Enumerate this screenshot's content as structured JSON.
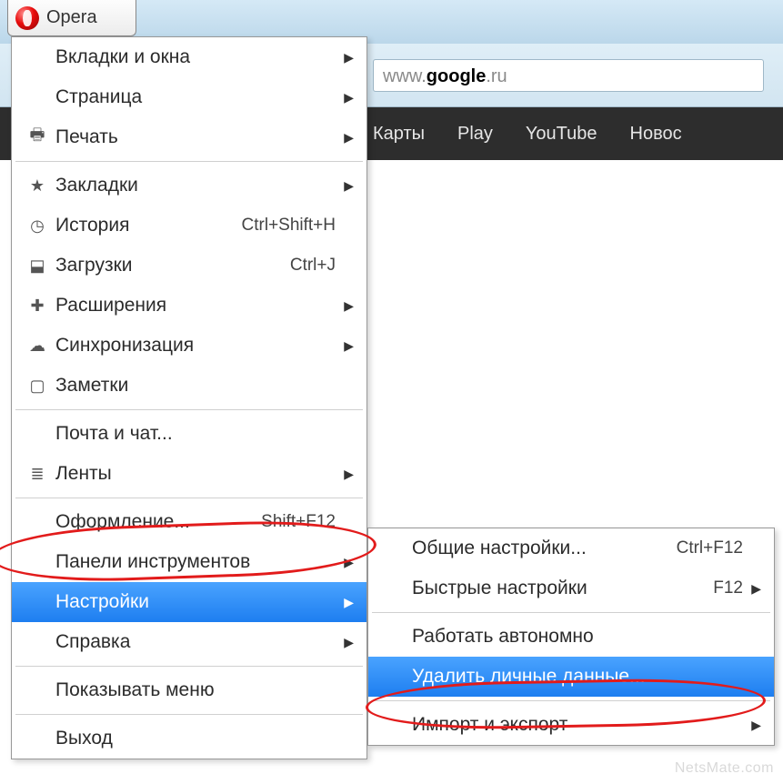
{
  "app_button": {
    "label": "Opera"
  },
  "address_bar": {
    "prefix": "www.",
    "domain": "google",
    "tld": ".ru"
  },
  "navbar": {
    "items": [
      "Карты",
      "Play",
      "YouTube",
      "Новос"
    ]
  },
  "main_menu": {
    "items": [
      {
        "icon": "",
        "label": "Вкладки и окна",
        "shortcut": "",
        "arrow": true
      },
      {
        "icon": "",
        "label": "Страница",
        "shortcut": "",
        "arrow": true
      },
      {
        "icon": "print",
        "label": "Печать",
        "shortcut": "",
        "arrow": true
      },
      {
        "sep": true
      },
      {
        "icon": "star",
        "label": "Закладки",
        "shortcut": "",
        "arrow": true
      },
      {
        "icon": "clock",
        "label": "История",
        "shortcut": "Ctrl+Shift+H",
        "arrow": false
      },
      {
        "icon": "download",
        "label": "Загрузки",
        "shortcut": "Ctrl+J",
        "arrow": false
      },
      {
        "icon": "puzzle",
        "label": "Расширения",
        "shortcut": "",
        "arrow": true
      },
      {
        "icon": "cloud",
        "label": "Синхронизация",
        "shortcut": "",
        "arrow": true
      },
      {
        "icon": "note",
        "label": "Заметки",
        "shortcut": "",
        "arrow": false
      },
      {
        "sep": true
      },
      {
        "icon": "",
        "label": "Почта и чат...",
        "shortcut": "",
        "arrow": false
      },
      {
        "icon": "rss",
        "label": "Ленты",
        "shortcut": "",
        "arrow": true
      },
      {
        "sep": true
      },
      {
        "icon": "",
        "label": "Оформление...",
        "shortcut": "Shift+F12",
        "arrow": false
      },
      {
        "icon": "",
        "label": "Панели инструментов",
        "shortcut": "",
        "arrow": true
      },
      {
        "icon": "",
        "label": "Настройки",
        "shortcut": "",
        "arrow": true,
        "selected": true
      },
      {
        "icon": "",
        "label": "Справка",
        "shortcut": "",
        "arrow": true
      },
      {
        "sep": true
      },
      {
        "icon": "",
        "label": "Показывать меню",
        "shortcut": "",
        "arrow": false
      },
      {
        "sep": true
      },
      {
        "icon": "",
        "label": "Выход",
        "shortcut": "",
        "arrow": false
      }
    ]
  },
  "sub_menu": {
    "items": [
      {
        "label": "Общие настройки...",
        "shortcut": "Ctrl+F12",
        "arrow": false
      },
      {
        "label": "Быстрые настройки",
        "shortcut": "F12",
        "arrow": true
      },
      {
        "sep": true
      },
      {
        "label": "Работать автономно",
        "shortcut": "",
        "arrow": false
      },
      {
        "label": "Удалить личные данные...",
        "shortcut": "",
        "arrow": false,
        "selected": true
      },
      {
        "sep": true
      },
      {
        "label": "Импорт и экспорт",
        "shortcut": "",
        "arrow": true
      }
    ]
  },
  "icons": {
    "print": "🖶",
    "star": "★",
    "clock": "◷",
    "download": "⬓",
    "puzzle": "✚",
    "cloud": "☁",
    "note": "▢",
    "rss": "≣"
  },
  "watermark": "NetsMate.com"
}
